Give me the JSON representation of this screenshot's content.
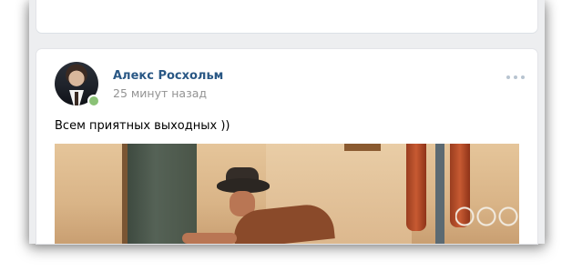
{
  "post": {
    "author_name": "Алекс Росхольм",
    "time_ago": "25 минут назад",
    "text": "Всем приятных выходных ))",
    "author_online": true
  },
  "icons": {
    "more": "more-dots-icon",
    "avatar": "avatar-photo",
    "online": "online-status-dot"
  },
  "colors": {
    "author_link": "#2a5885",
    "meta_text": "#939393",
    "online_dot": "#8ac176",
    "page_bg": "#edeef0"
  }
}
